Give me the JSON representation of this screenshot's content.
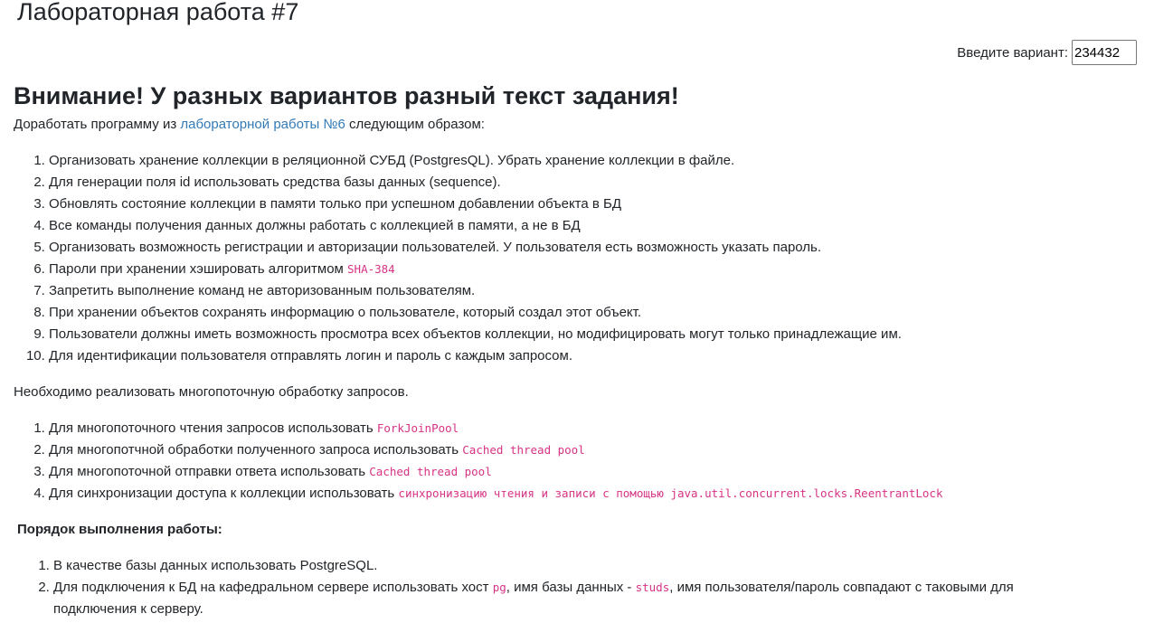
{
  "header": {
    "title": "Лабораторная работа #7",
    "variant_label": "Введите вариант:",
    "variant_value": "234432"
  },
  "warning": "Внимание! У разных вариантов разный текст задания!",
  "intro": {
    "before": "Доработать программу из ",
    "link": "лабораторной работы №6",
    "after": " следующим образом:"
  },
  "tasks": [
    {
      "text": "Организовать хранение коллекции в реляционной СУБД (PostgresQL). Убрать хранение коллекции в файле.",
      "code": ""
    },
    {
      "text": "Для генерации поля id использовать средства базы данных (sequence).",
      "code": ""
    },
    {
      "text": "Обновлять состояние коллекции в памяти только при успешном добавлении объекта в БД",
      "code": ""
    },
    {
      "text": "Все команды получения данных должны работать с коллекцией в памяти, а не в БД",
      "code": ""
    },
    {
      "text": "Организовать возможность регистрации и авторизации пользователей. У пользователя есть возможность указать пароль.",
      "code": ""
    },
    {
      "text": "Пароли при хранении хэшировать алгоритмом ",
      "code": "SHA-384"
    },
    {
      "text": "Запретить выполнение команд не авторизованным пользователям.",
      "code": ""
    },
    {
      "text": "При хранении объектов сохранять информацию о пользователе, который создал этот объект.",
      "code": ""
    },
    {
      "text": "Пользователи должны иметь возможность просмотра всех объектов коллекции, но модифицировать могут только принадлежащие им.",
      "code": ""
    },
    {
      "text": "Для идентификации пользователя отправлять логин и пароль с каждым запросом.",
      "code": ""
    }
  ],
  "multithread_intro": "Необходимо реализовать многопоточную обработку запросов.",
  "multithread": [
    {
      "text": "Для многопоточного чтения запросов использовать ",
      "code": "ForkJoinPool"
    },
    {
      "text": "Для многопотчной обработки полученного запроса использовать ",
      "code": "Cached thread pool"
    },
    {
      "text": "Для многопоточной отправки ответа использовать ",
      "code": "Cached thread pool"
    },
    {
      "text": "Для синхронизации доступа к коллекции использовать ",
      "code": "синхронизацию чтения и записи с помощью java.util.concurrent.locks.ReentrantLock"
    }
  ],
  "order_title": "Порядок выполнения работы:",
  "order": {
    "item1": "В качестве базы данных использовать PostgreSQL.",
    "item2_a": "Для подключения к БД на кафедральном сервере использовать хост ",
    "item2_code1": "pg",
    "item2_b": ", имя базы данных - ",
    "item2_code2": "studs",
    "item2_c": ", имя пользователя/пароль совпадают с таковыми для подключения к серверу."
  }
}
